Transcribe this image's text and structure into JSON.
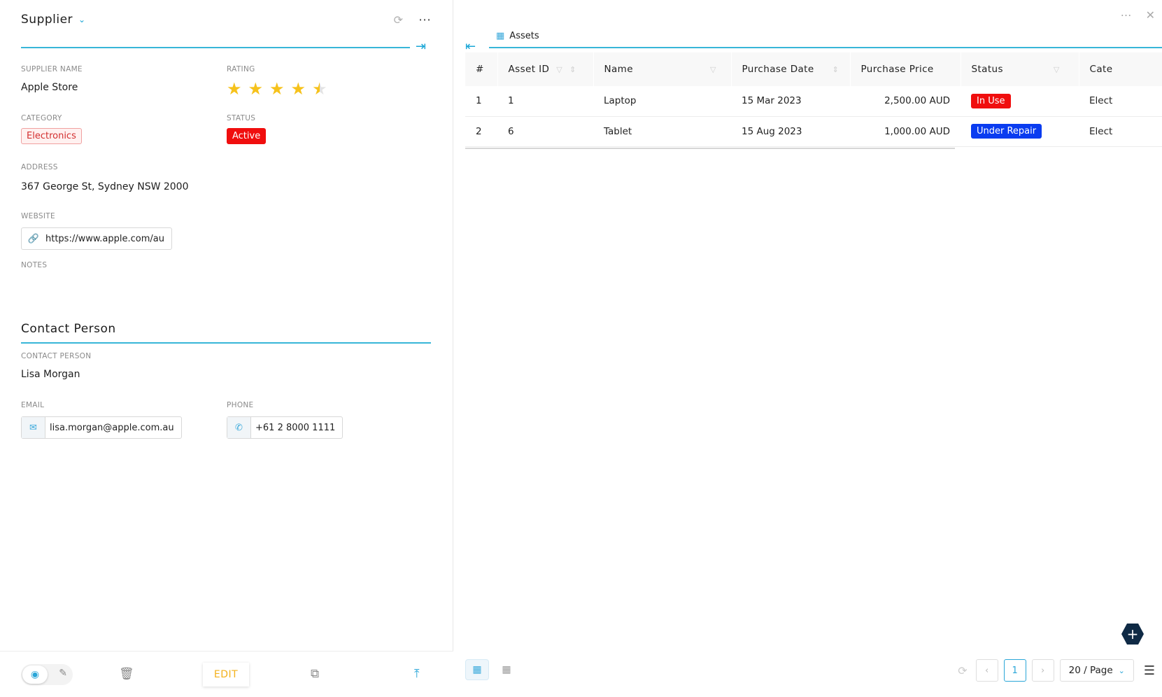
{
  "left": {
    "title": "Supplier",
    "fields": {
      "supplier_name_label": "SUPPLIER NAME",
      "supplier_name": "Apple Store",
      "rating_label": "RATING",
      "rating_value": 4.5,
      "category_label": "CATEGORY",
      "category": "Electronics",
      "status_label": "STATUS",
      "status": "Active",
      "address_label": "ADDRESS",
      "address": "367 George St, Sydney NSW 2000",
      "website_label": "WEBSITE",
      "website": "https://www.apple.com/au",
      "notes_label": "NOTES"
    },
    "contact": {
      "section_title": "Contact Person",
      "contact_person_label": "CONTACT PERSON",
      "contact_person": "Lisa Morgan",
      "email_label": "EMAIL",
      "email": "lisa.morgan@apple.com.au",
      "phone_label": "PHONE",
      "phone": "+61 2 8000 1111"
    },
    "footer": {
      "edit_label": "EDIT"
    }
  },
  "right": {
    "tab_label": "Assets",
    "columns": [
      "#",
      "Asset ID",
      "Name",
      "Purchase Date",
      "Purchase Price",
      "Status",
      "Cate"
    ],
    "rows": [
      {
        "idx": "1",
        "asset_id": "1",
        "name": "Laptop",
        "purchase_date": "15 Mar 2023",
        "purchase_price": "2,500.00 AUD",
        "status": "In Use",
        "status_color": "#f00e0e",
        "category": "Elect"
      },
      {
        "idx": "2",
        "asset_id": "6",
        "name": "Tablet",
        "purchase_date": "15 Aug 2023",
        "purchase_price": "1,000.00 AUD",
        "status": "Under Repair",
        "status_color": "#0a3cf0",
        "category": "Elect"
      }
    ],
    "pager": {
      "current_page": "1",
      "page_size": "20 / Page"
    }
  },
  "colors": {
    "accent": "#38b6d8",
    "star": "#f6c21b",
    "edit": "#f3b11b"
  }
}
